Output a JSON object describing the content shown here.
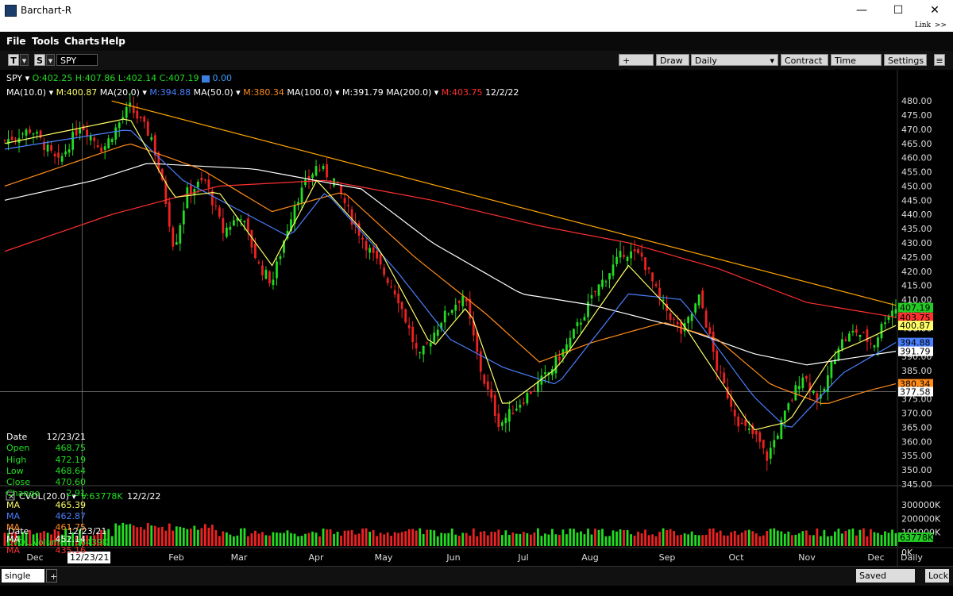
{
  "window": {
    "title": "Barchart-R",
    "minimize": "—",
    "maximize": "☐",
    "close": "✕"
  },
  "linkbar": {
    "link": "Link",
    "more": ">>"
  },
  "menu": [
    "File",
    "Tools",
    "Charts",
    "Help"
  ],
  "toolbar": {
    "t_button": "T",
    "s_button": "S",
    "symbol": "SPY",
    "study": "+ Study",
    "draw": "Draw",
    "period": "Daily",
    "contract": "Contract",
    "time_range": "Time Range",
    "settings": "Settings"
  },
  "quote": {
    "symbol": "SPY ▾",
    "o": "O:402.25",
    "h": "H:407.86",
    "l": "L:402.14",
    "c": "C:407.19",
    "chg": "0.00"
  },
  "ma_legend": [
    {
      "name": "MA(10.0) ▾",
      "m": "M:400.87",
      "color": "#ffff66"
    },
    {
      "name": "MA(20.0) ▾",
      "m": "M:394.88",
      "color": "#4a7fff"
    },
    {
      "name": "MA(50.0) ▾",
      "m": "M:380.34",
      "color": "#ff8c1a"
    },
    {
      "name": "MA(100.0) ▾",
      "m": "M:391.79",
      "color": "#ffffff"
    },
    {
      "name": "MA(200.0) ▾",
      "m": "M:403.75",
      "color": "#ff3030"
    }
  ],
  "legend_date": "12/2/22",
  "hover_panel": [
    {
      "label": "Date",
      "value": "12/23/21",
      "lc": "#ffffff",
      "vc": "#ffffff"
    },
    {
      "label": "Open",
      "value": "468.75",
      "lc": "#22dd22",
      "vc": "#22dd22"
    },
    {
      "label": "High",
      "value": "472.19",
      "lc": "#22dd22",
      "vc": "#22dd22"
    },
    {
      "label": "Low",
      "value": "468.64",
      "lc": "#22dd22",
      "vc": "#22dd22"
    },
    {
      "label": "Close",
      "value": "470.60",
      "lc": "#22dd22",
      "vc": "#22dd22"
    },
    {
      "label": "Change",
      "value": "2.91",
      "lc": "#22dd22",
      "vc": "#22dd22"
    },
    {
      "label": "MA",
      "value": "465.39",
      "lc": "#ffff66",
      "vc": "#ffff66"
    },
    {
      "label": "MA",
      "value": "462.87",
      "lc": "#4a7fff",
      "vc": "#4a7fff"
    },
    {
      "label": "MA",
      "value": "461.75",
      "lc": "#ff8c1a",
      "vc": "#ff8c1a"
    },
    {
      "label": "MA",
      "value": "452.14",
      "lc": "#ffffff",
      "vc": "#ffffff"
    },
    {
      "label": "MA",
      "value": "435.16",
      "lc": "#ff3030",
      "vc": "#ff3030"
    }
  ],
  "price_axis": [
    "480.00",
    "475.00",
    "470.00",
    "465.00",
    "460.00",
    "455.00",
    "450.00",
    "445.00",
    "440.00",
    "435.00",
    "430.00",
    "425.00",
    "420.00",
    "415.00",
    "410.00",
    "405.00",
    "400.00",
    "395.00",
    "390.00",
    "385.00",
    "380.00",
    "375.00",
    "370.00",
    "365.00",
    "360.00",
    "355.00",
    "350.00",
    "345.00"
  ],
  "price_tags": [
    {
      "value": "407.19",
      "price": 407.19,
      "bg": "#22cc22",
      "fg": "#000000"
    },
    {
      "value": "403.75",
      "price": 403.75,
      "bg": "#ff3030",
      "fg": "#000000"
    },
    {
      "value": "400.87",
      "price": 400.87,
      "bg": "#ffff66",
      "fg": "#000000"
    },
    {
      "value": "394.88",
      "price": 394.88,
      "bg": "#4a7fff",
      "fg": "#000000"
    },
    {
      "value": "391.79",
      "price": 391.79,
      "bg": "#ffffff",
      "fg": "#000000"
    },
    {
      "value": "380.34",
      "price": 380.34,
      "bg": "#ff8c1a",
      "fg": "#000000"
    },
    {
      "value": "377.58",
      "price": 377.58,
      "bg": "#ffffff",
      "fg": "#000000"
    }
  ],
  "crosshair_price": 377.58,
  "volume": {
    "legend_name": "CVOL(20.0) ▾",
    "legend_value": "V:63778K",
    "legend_date": "12/2/22",
    "axis": [
      "300000K",
      "200000K",
      "100000K"
    ],
    "zero_label": "0K",
    "current_tag": "63778K",
    "hover_date_label": "Date",
    "hover_date": "12/23/21",
    "hover_vol_label": "CVOL.Volume",
    "hover_vol": "56439K"
  },
  "time_axis": [
    "Dec",
    "Feb",
    "Mar",
    "Apr",
    "May",
    "Jun",
    "Jul",
    "Aug",
    "Sep",
    "Oct",
    "Nov",
    "Dec"
  ],
  "time_axis_hover": "12/23/21",
  "time_axis_period": "Daily",
  "bottombar": {
    "tab": "single",
    "add": "+",
    "saved_charts": "Saved Charts",
    "lock": "Lock"
  },
  "chart_data": {
    "type": "candlestick",
    "symbol": "SPY",
    "period": "Daily",
    "date_range": [
      "Dec 2021",
      "Dec 2022"
    ],
    "ylim": [
      345,
      482
    ],
    "close_path": [
      {
        "t": 0.0,
        "c": 466
      },
      {
        "t": 0.03,
        "c": 470
      },
      {
        "t": 0.06,
        "c": 458
      },
      {
        "t": 0.085,
        "c": 472
      },
      {
        "t": 0.11,
        "c": 463
      },
      {
        "t": 0.14,
        "c": 478
      },
      {
        "t": 0.165,
        "c": 467
      },
      {
        "t": 0.18,
        "c": 446
      },
      {
        "t": 0.19,
        "c": 428
      },
      {
        "t": 0.205,
        "c": 448
      },
      {
        "t": 0.225,
        "c": 452
      },
      {
        "t": 0.245,
        "c": 434
      },
      {
        "t": 0.265,
        "c": 440
      },
      {
        "t": 0.285,
        "c": 422
      },
      {
        "t": 0.3,
        "c": 416
      },
      {
        "t": 0.325,
        "c": 444
      },
      {
        "t": 0.35,
        "c": 457
      },
      {
        "t": 0.37,
        "c": 452
      },
      {
        "t": 0.39,
        "c": 438
      },
      {
        "t": 0.41,
        "c": 427
      },
      {
        "t": 0.44,
        "c": 412
      },
      {
        "t": 0.465,
        "c": 389
      },
      {
        "t": 0.49,
        "c": 403
      },
      {
        "t": 0.515,
        "c": 412
      },
      {
        "t": 0.535,
        "c": 384
      },
      {
        "t": 0.555,
        "c": 366
      },
      {
        "t": 0.585,
        "c": 376
      },
      {
        "t": 0.61,
        "c": 384
      },
      {
        "t": 0.635,
        "c": 396
      },
      {
        "t": 0.665,
        "c": 414
      },
      {
        "t": 0.695,
        "c": 427
      },
      {
        "t": 0.715,
        "c": 425
      },
      {
        "t": 0.735,
        "c": 410
      },
      {
        "t": 0.76,
        "c": 398
      },
      {
        "t": 0.78,
        "c": 411
      },
      {
        "t": 0.8,
        "c": 385
      },
      {
        "t": 0.825,
        "c": 366
      },
      {
        "t": 0.845,
        "c": 361
      },
      {
        "t": 0.855,
        "c": 354
      },
      {
        "t": 0.875,
        "c": 369
      },
      {
        "t": 0.895,
        "c": 384
      },
      {
        "t": 0.915,
        "c": 374
      },
      {
        "t": 0.935,
        "c": 394
      },
      {
        "t": 0.955,
        "c": 399
      },
      {
        "t": 0.975,
        "c": 394
      },
      {
        "t": 0.99,
        "c": 405
      },
      {
        "t": 1.0,
        "c": 407.19
      }
    ],
    "moving_averages": {
      "MA10": [
        {
          "t": 0,
          "v": 465
        },
        {
          "t": 0.14,
          "v": 474
        },
        {
          "t": 0.19,
          "v": 446
        },
        {
          "t": 0.24,
          "v": 448
        },
        {
          "t": 0.3,
          "v": 422
        },
        {
          "t": 0.35,
          "v": 452
        },
        {
          "t": 0.42,
          "v": 428
        },
        {
          "t": 0.48,
          "v": 393
        },
        {
          "t": 0.52,
          "v": 408
        },
        {
          "t": 0.56,
          "v": 372
        },
        {
          "t": 0.62,
          "v": 386
        },
        {
          "t": 0.7,
          "v": 422
        },
        {
          "t": 0.76,
          "v": 402
        },
        {
          "t": 0.84,
          "v": 364
        },
        {
          "t": 0.88,
          "v": 367
        },
        {
          "t": 0.93,
          "v": 391
        },
        {
          "t": 0.96,
          "v": 395
        },
        {
          "t": 1.0,
          "v": 400.87
        }
      ],
      "MA20": [
        {
          "t": 0,
          "v": 463
        },
        {
          "t": 0.14,
          "v": 470
        },
        {
          "t": 0.2,
          "v": 452
        },
        {
          "t": 0.26,
          "v": 442
        },
        {
          "t": 0.32,
          "v": 432
        },
        {
          "t": 0.36,
          "v": 448
        },
        {
          "t": 0.44,
          "v": 420
        },
        {
          "t": 0.5,
          "v": 396
        },
        {
          "t": 0.56,
          "v": 386
        },
        {
          "t": 0.62,
          "v": 380
        },
        {
          "t": 0.7,
          "v": 412
        },
        {
          "t": 0.76,
          "v": 410
        },
        {
          "t": 0.84,
          "v": 376
        },
        {
          "t": 0.88,
          "v": 364
        },
        {
          "t": 0.94,
          "v": 384
        },
        {
          "t": 1.0,
          "v": 394.88
        }
      ],
      "MA50": [
        {
          "t": 0,
          "v": 450
        },
        {
          "t": 0.14,
          "v": 465
        },
        {
          "t": 0.22,
          "v": 456
        },
        {
          "t": 0.3,
          "v": 441
        },
        {
          "t": 0.38,
          "v": 448
        },
        {
          "t": 0.46,
          "v": 425
        },
        {
          "t": 0.54,
          "v": 405
        },
        {
          "t": 0.6,
          "v": 388
        },
        {
          "t": 0.66,
          "v": 395
        },
        {
          "t": 0.74,
          "v": 402
        },
        {
          "t": 0.8,
          "v": 396
        },
        {
          "t": 0.86,
          "v": 380
        },
        {
          "t": 0.92,
          "v": 373
        },
        {
          "t": 0.97,
          "v": 378
        },
        {
          "t": 1.0,
          "v": 380.34
        }
      ],
      "MA100": [
        {
          "t": 0,
          "v": 445
        },
        {
          "t": 0.1,
          "v": 452
        },
        {
          "t": 0.16,
          "v": 458
        },
        {
          "t": 0.28,
          "v": 456
        },
        {
          "t": 0.4,
          "v": 449
        },
        {
          "t": 0.48,
          "v": 430
        },
        {
          "t": 0.58,
          "v": 412
        },
        {
          "t": 0.66,
          "v": 408
        },
        {
          "t": 0.76,
          "v": 400
        },
        {
          "t": 0.84,
          "v": 391
        },
        {
          "t": 0.9,
          "v": 387
        },
        {
          "t": 1.0,
          "v": 391.79
        }
      ],
      "MA200": [
        {
          "t": 0,
          "v": 427
        },
        {
          "t": 0.12,
          "v": 440
        },
        {
          "t": 0.24,
          "v": 450
        },
        {
          "t": 0.36,
          "v": 452
        },
        {
          "t": 0.48,
          "v": 445
        },
        {
          "t": 0.6,
          "v": 436
        },
        {
          "t": 0.7,
          "v": 430
        },
        {
          "t": 0.8,
          "v": 421
        },
        {
          "t": 0.9,
          "v": 409
        },
        {
          "t": 1.0,
          "v": 403.75
        }
      ]
    },
    "trendline": [
      {
        "t": 0.12,
        "v": 480
      },
      {
        "t": 1.0,
        "v": 408
      }
    ]
  },
  "colors": {
    "up": "#22dd22",
    "down": "#ee2222",
    "trend": "#ffa500",
    "ma10": "#ffff66",
    "ma20": "#4a7fff",
    "ma50": "#ff8c1a",
    "ma100": "#ffffff",
    "ma200": "#ff3030"
  }
}
